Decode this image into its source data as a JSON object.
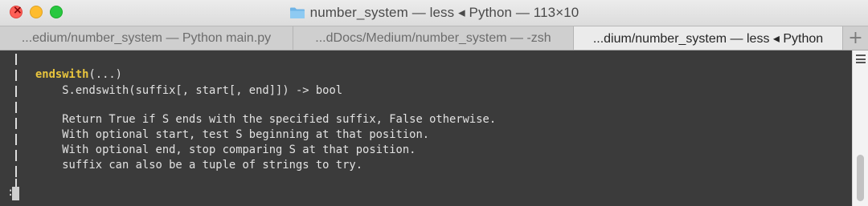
{
  "window": {
    "title": "number_system — less ◂ Python — 113×10"
  },
  "tabs": [
    {
      "label": "...edium/number_system — Python main.py",
      "active": false
    },
    {
      "label": "...dDocs/Medium/number_system — -zsh",
      "active": false
    },
    {
      "label": "...dium/number_system — less ◂ Python",
      "active": true
    }
  ],
  "new_tab_label": "+",
  "terminal": {
    "keyword": "endswith",
    "keyword_suffix": "(...)",
    "signature": "    S.endswith(suffix[, start[, end]]) -> bool",
    "doc_lines": [
      "    Return True if S ends with the specified suffix, False otherwise.",
      "    With optional start, test S beginning at that position.",
      "    With optional end, stop comparing S at that position.",
      "    suffix can also be a tuple of strings to try."
    ],
    "prompt": ":"
  },
  "colors": {
    "terminal_bg": "#3b3b3b",
    "terminal_text": "#e2e2e2",
    "keyword": "#e9c53d",
    "close": "#fe5f57",
    "minimize": "#febc2e",
    "maximize": "#28c840"
  }
}
